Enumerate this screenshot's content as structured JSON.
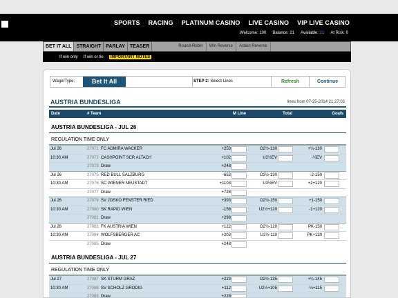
{
  "header": {
    "nav": [
      "SPORTS",
      "RACING",
      "PLATINUM CASINO",
      "LIVE CASINO",
      "VIP LIVE CASINO"
    ],
    "account": {
      "welcome_label": "Welcome:",
      "welcome_value": "100",
      "balance_label": "Balance:",
      "balance_value": "21",
      "available_label": "Available:",
      "available_value": "21",
      "at_risk_label": "At Risk:",
      "at_risk_value": "0"
    }
  },
  "bet_types": [
    "BET IT ALL",
    "STRAIGHT",
    "PARLAY",
    "TEASER"
  ],
  "bet_subtypes": [
    "Round-Robin",
    "Win Reverse",
    "Action Reverse"
  ],
  "options": {
    "if_win_only": "If win only",
    "if_win_or_tie": "If win or tie",
    "important_notes": "IMPORTANT NOTES"
  },
  "wager": {
    "label": "WagerType:",
    "type": "Bet It All",
    "step_bold": "STEP 2:",
    "step_text": "Select Lines",
    "refresh": "Refresh",
    "continue": "Continue"
  },
  "league": {
    "title": "AUSTRIA BUNDESLIGA",
    "lines_from": "lines from 07-25-2014 21:27:03"
  },
  "columns": {
    "date": "Date",
    "team": "# Team",
    "moneyline": "M Line",
    "total": "Total",
    "goals": "Goals"
  },
  "sections": [
    {
      "heading": "AUSTRIA BUNDESLIGA - JUL 26",
      "period": "REGULATION TIME ONLY",
      "rows": [
        {
          "date": "Jul 26",
          "rot": "27071",
          "team": "FC ADMIRA WACKER",
          "ml": "+253",
          "total": "O2½-130",
          "goals": "+¼-130",
          "alt": true,
          "start": true
        },
        {
          "date": "10:30 AM",
          "rot": "27072",
          "team": "CASHPOINT SCR ALTACH",
          "ml": "+102",
          "total": "U2½EV",
          "goals": "-¼EV",
          "alt": true,
          "start": false
        },
        {
          "date": "",
          "rot": "27073",
          "team": "Draw",
          "ml": "+248",
          "total": "",
          "goals": "",
          "alt": true,
          "start": false
        },
        {
          "date": "Jul 26",
          "rot": "27075",
          "team": "RED BULL SALZBURG",
          "ml": "-653",
          "total": "O3½-130",
          "goals": "-2-150",
          "alt": false,
          "start": true
        },
        {
          "date": "10:30 AM",
          "rot": "27076",
          "team": "SC WIENER NEUSTADT",
          "ml": "+1103",
          "total": "U3½EV",
          "goals": "+2+120",
          "alt": false,
          "start": false
        },
        {
          "date": "",
          "rot": "27077",
          "team": "Draw",
          "ml": "+728",
          "total": "",
          "goals": "",
          "alt": false,
          "start": false
        },
        {
          "date": "Jul 26",
          "rot": "27079",
          "team": "SV JOSKO FENSTER RIED",
          "ml": "+393",
          "total": "O2½-150",
          "goals": "+1-150",
          "alt": true,
          "start": true
        },
        {
          "date": "10:30 AM",
          "rot": "27080",
          "team": "SK RAPID WIEN",
          "ml": "-158",
          "total": "U2½+120",
          "goals": "-1+120",
          "alt": true,
          "start": false
        },
        {
          "date": "",
          "rot": "27081",
          "team": "Draw",
          "ml": "+298",
          "total": "",
          "goals": "",
          "alt": true,
          "start": false
        },
        {
          "date": "Jul 26",
          "rot": "27083",
          "team": "FK AUSTRIA WIEN",
          "ml": "+122",
          "total": "O2½-120",
          "goals": "PK-150",
          "alt": false,
          "start": true
        },
        {
          "date": "10:30 AM",
          "rot": "27084",
          "team": "WOLFSBERGER AC",
          "ml": "+203",
          "total": "U2½-110",
          "goals": "PK+120",
          "alt": false,
          "start": false
        },
        {
          "date": "",
          "rot": "27085",
          "team": "Draw",
          "ml": "+248",
          "total": "",
          "goals": "",
          "alt": false,
          "start": false
        }
      ]
    },
    {
      "heading": "AUSTRIA BUNDESLIGA - JUL 27",
      "period": "REGULATION TIME ONLY",
      "rows": [
        {
          "date": "Jul 27",
          "rot": "27087",
          "team": "SK STURM GRAZ",
          "ml": "+223",
          "total": "O2½-135",
          "goals": "+¼-145",
          "alt": true,
          "start": true
        },
        {
          "date": "10:30 AM",
          "rot": "27088",
          "team": "SV SCHOLZ GRODIG",
          "ml": "+112",
          "total": "U2½+105",
          "goals": "-¼+115",
          "alt": true,
          "start": false
        },
        {
          "date": "",
          "rot": "27089",
          "team": "Draw",
          "ml": "+228",
          "total": "",
          "goals": "",
          "alt": true,
          "start": false
        }
      ]
    }
  ]
}
